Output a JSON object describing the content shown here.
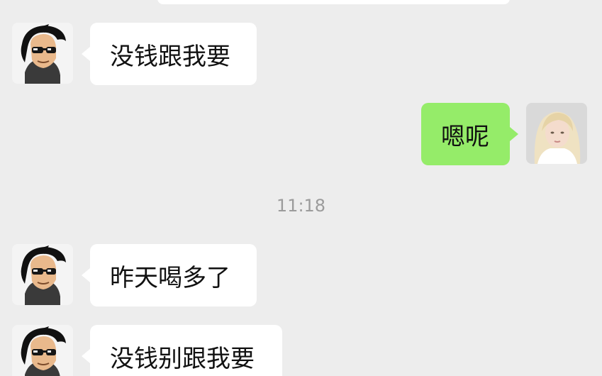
{
  "chat": {
    "messages": [
      {
        "text": "没钱跟我要"
      },
      {
        "text": "嗯呢"
      },
      {
        "text": "昨天喝多了"
      },
      {
        "text": "没钱别跟我要"
      }
    ],
    "timestamp": "11:18"
  },
  "avatars": {
    "sender": "man-with-sunglasses-cartoon",
    "receiver": "blonde-woman-photo"
  }
}
